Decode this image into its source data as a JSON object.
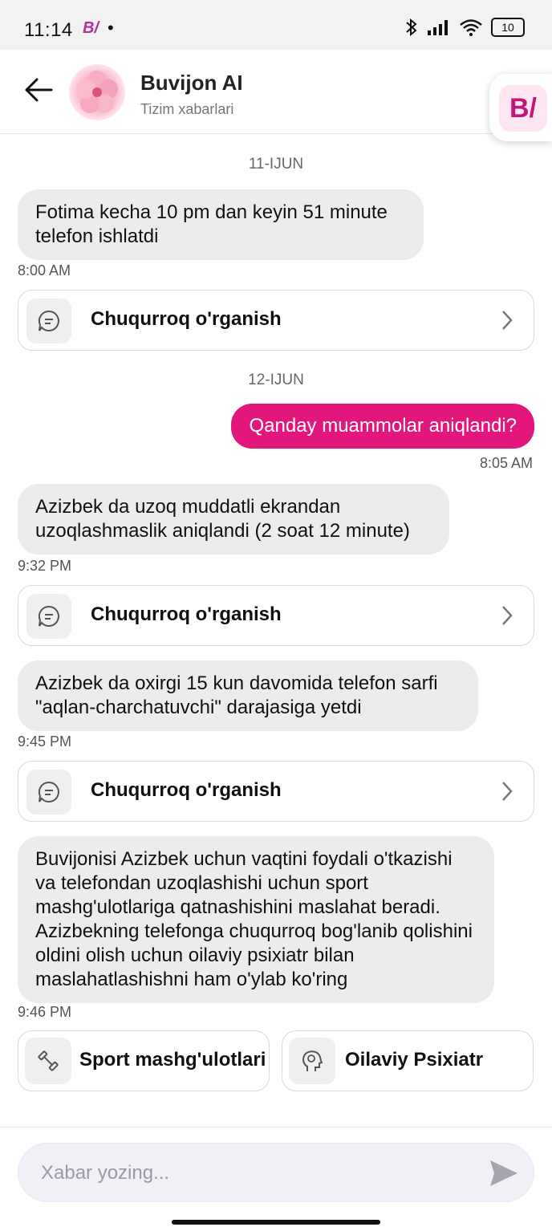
{
  "status_bar": {
    "time": "11:14",
    "app_logo": "B/",
    "dot": "•",
    "battery": "10"
  },
  "header": {
    "title": "Buvijon AI",
    "subtitle": "Tizim xabarlari",
    "brand_logo": "B/"
  },
  "dates": [
    "11-IJUN",
    "12-IJUN"
  ],
  "messages": [
    {
      "text": "Fotima kecha 10 pm dan keyin 51 minute telefon ishlatdi",
      "time": "8:00 AM",
      "action": "Chuqurroq o'rganish"
    },
    {
      "text": "Qanday muammolar aniqlandi?",
      "time": "8:05 AM"
    },
    {
      "text": "Azizbek da uzoq muddatli ekrandan uzoqlashmaslik aniqlandi (2 soat 12 minute)",
      "time": "9:32 PM",
      "action": "Chuqurroq o'rganish"
    },
    {
      "text": "Azizbek da oxirgi 15 kun davomida telefon sarfi \"aqlan-charchatuvchi\" darajasiga yetdi",
      "time": "9:45 PM",
      "action": "Chuqurroq o'rganish"
    },
    {
      "text": "Buvijonisi Azizbek uchun vaqtini foydali o'tkazishi va telefondan uzoqlashishi uchun sport mashg'ulotlariga qatnashishini maslahat beradi. Azizbekning telefonga chuqurroq bog'lanib qolishini oldini olish uchun oilaviy psixiatr bilan maslahatlashishni ham o'ylab ko'ring",
      "time": "9:46 PM"
    }
  ],
  "suggestions": [
    {
      "label": "Sport mashg'ulotlari",
      "icon": "dumbbell-icon"
    },
    {
      "label": "Oilaviy Psixiatr",
      "icon": "brain-head-icon"
    }
  ],
  "composer": {
    "placeholder": "Xabar yozing..."
  },
  "colors": {
    "accent": "#e3177b",
    "bubble_in": "#ececec",
    "brand": "#c4167a"
  }
}
